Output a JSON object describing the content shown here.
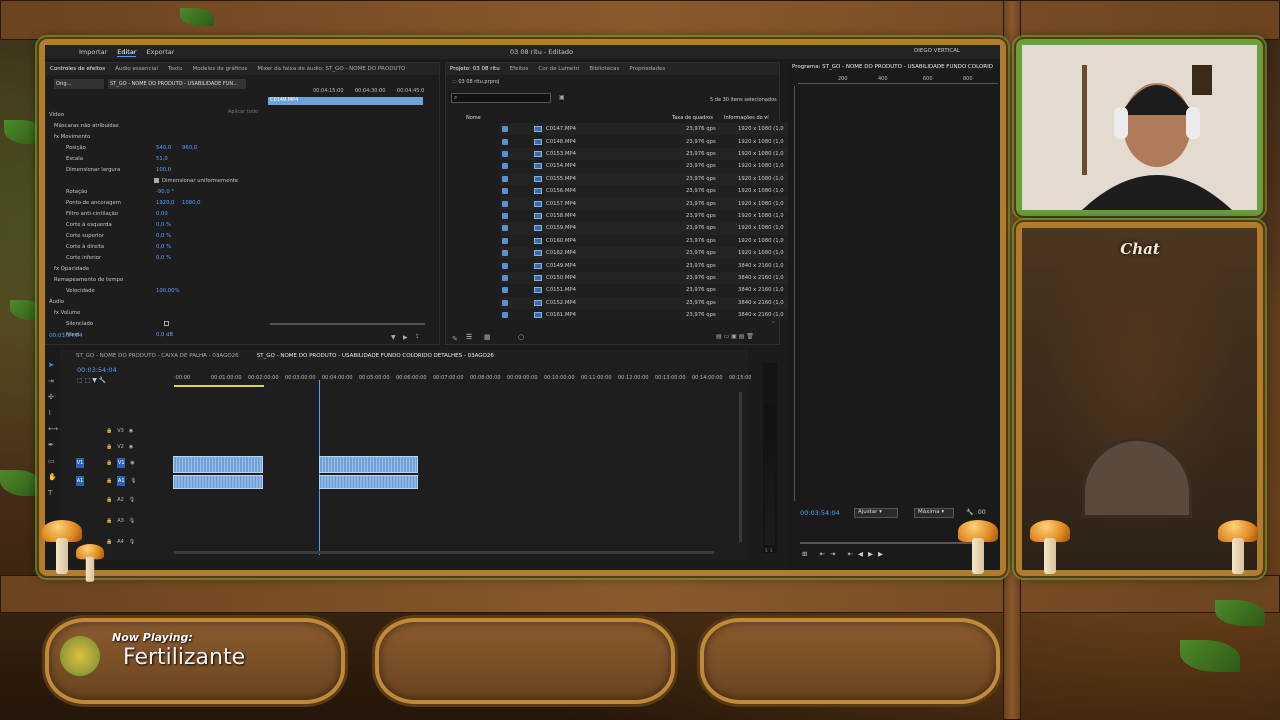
{
  "premiere": {
    "menu": {
      "importar": "Importar",
      "editar": "Editar",
      "exportar": "Exportar"
    },
    "window_title": "03 08 ritu - Editado",
    "workspace_user": "DIEGO VERTICAL",
    "effect_controls": {
      "tabs": [
        "Controles de efeitos",
        "Áudio essencial",
        "Texto",
        "Modelos de gráficos",
        "Mixer da faixa de áudio: ST_GO - NOME DO PRODUTO"
      ],
      "source_label": "Orig...",
      "sequence_label": "ST_GO - NOME DO PRODUTO - USABILIDADE FUN...",
      "clip_name": "C0149.MP4",
      "apply_label": "Aplicar todo",
      "rows": [
        {
          "label": "Vídeo",
          "v1": "",
          "v2": ""
        },
        {
          "label": "Máscaras não atribuídas",
          "v1": "",
          "v2": ""
        },
        {
          "label": "fx Movimento",
          "v1": "",
          "v2": ""
        },
        {
          "label": "Posição",
          "v1": "540,0",
          "v2": "960,0"
        },
        {
          "label": "Escala",
          "v1": "51,0",
          "v2": ""
        },
        {
          "label": "Dimensionar largura",
          "v1": "100,0",
          "v2": ""
        },
        {
          "label": "Dimensionar uniformemente",
          "v1": "",
          "v2": ""
        },
        {
          "label": "Rotação",
          "v1": "-90,0 °",
          "v2": ""
        },
        {
          "label": "Ponto de ancoragem",
          "v1": "1920,0",
          "v2": "1080,0"
        },
        {
          "label": "Filtro anti-cintilação",
          "v1": "0,00",
          "v2": ""
        },
        {
          "label": "Corte à esquerda",
          "v1": "0,0 %",
          "v2": ""
        },
        {
          "label": "Corte superior",
          "v1": "0,0 %",
          "v2": ""
        },
        {
          "label": "Corte à direita",
          "v1": "0,0 %",
          "v2": ""
        },
        {
          "label": "Corte inferior",
          "v1": "0,0 %",
          "v2": ""
        },
        {
          "label": "fx Opacidade",
          "v1": "",
          "v2": ""
        },
        {
          "label": "Remapeamento de tempo",
          "v1": "",
          "v2": ""
        },
        {
          "label": "Velocidade",
          "v1": "100,00%",
          "v2": ""
        },
        {
          "label": "Áudio",
          "v1": "",
          "v2": ""
        },
        {
          "label": "fx Volume",
          "v1": "",
          "v2": ""
        },
        {
          "label": "Silenciado",
          "v1": "",
          "v2": ""
        },
        {
          "label": "Nível",
          "v1": "0,0 dB",
          "v2": ""
        }
      ],
      "timecode": "00:03:54:04",
      "mini_ruler": [
        "00:04:15:00",
        "00:04:30:00",
        "00:04:45:0"
      ]
    },
    "project": {
      "tabs": [
        "Projeto: 03 08 ritu",
        "Efeitos",
        "Cor de Lumetri",
        "Bibliotecas",
        "Propriedades"
      ],
      "bin_name": "03 08 ritu.prproj",
      "selection_status": "5 de 30 itens selecionados",
      "columns": [
        "Nome",
        "Taxa de quadros",
        "Informações do ví"
      ],
      "files": [
        {
          "name": "C0147.MP4",
          "fps": "23,976 qps",
          "info": "1920 x 1080 (1,0"
        },
        {
          "name": "C0148.MP4",
          "fps": "23,976 qps",
          "info": "1920 x 1080 (1,0"
        },
        {
          "name": "C0153.MP4",
          "fps": "23,976 qps",
          "info": "1920 x 1080 (1,0"
        },
        {
          "name": "C0154.MP4",
          "fps": "23,976 qps",
          "info": "1920 x 1080 (1,0"
        },
        {
          "name": "C0155.MP4",
          "fps": "23,976 qps",
          "info": "1920 x 1080 (1,0"
        },
        {
          "name": "C0156.MP4",
          "fps": "23,976 qps",
          "info": "1920 x 1080 (1,0"
        },
        {
          "name": "C0157.MP4",
          "fps": "23,976 qps",
          "info": "1920 x 1080 (1,0"
        },
        {
          "name": "C0158.MP4",
          "fps": "23,976 qps",
          "info": "1920 x 1080 (1,0"
        },
        {
          "name": "C0159.MP4",
          "fps": "23,976 qps",
          "info": "1920 x 1080 (1,0"
        },
        {
          "name": "C0160.MP4",
          "fps": "23,976 qps",
          "info": "1920 x 1080 (1,0"
        },
        {
          "name": "C0162.MP4",
          "fps": "23,976 qps",
          "info": "1920 x 1080 (1,0"
        },
        {
          "name": "C0149.MP4",
          "fps": "23,976 qps",
          "info": "3840 x 2160 (1,0"
        },
        {
          "name": "C0150.MP4",
          "fps": "23,976 qps",
          "info": "3840 x 2160 (1,0"
        },
        {
          "name": "C0151.MP4",
          "fps": "23,976 qps",
          "info": "3840 x 2160 (1,0"
        },
        {
          "name": "C0152.MP4",
          "fps": "23,976 qps",
          "info": "3840 x 2160 (1,0"
        },
        {
          "name": "C0161.MP4",
          "fps": "23,976 qps",
          "info": "3840 x 2160 (1,0"
        }
      ]
    },
    "program": {
      "title": "Programa: ST_GO - NOME DO PRODUTO - USABILIDADE FUNDO COLORID",
      "ruler": [
        "200",
        "400",
        "600",
        "800"
      ],
      "timecode": "00:03:54:04",
      "fit": "Ajustar",
      "quality": "Máxima",
      "end_label": "00"
    },
    "timeline": {
      "tabs": [
        "ST_GO - NOME DO PRODUTO - CAIXA DE PALHA - 03AGO26",
        "ST_GO - NOME DO PRODUTO - USABILIDADE FUNDO COLORIDO DETALHES - 03AGO26"
      ],
      "timecode": "00:03:54:04",
      "ruler": [
        ":00:00",
        "00:01:00:00",
        "00:02:00:00",
        "00:03:00:00",
        "00:04:00:00",
        "00:05:00:00",
        "00:06:00:00",
        "00:07:00:00",
        "00:08:00:00",
        "00:09:00:00",
        "00:10:00:00",
        "00:11:00:00",
        "00:12:00:00",
        "00:13:00:00",
        "00:14:00:00",
        "00:15:00"
      ],
      "tracks": [
        {
          "id": "V3",
          "kind": "video"
        },
        {
          "id": "V2",
          "kind": "video"
        },
        {
          "id": "V1",
          "kind": "video",
          "source": "V1"
        },
        {
          "id": "A1",
          "kind": "audio",
          "source": "A1"
        },
        {
          "id": "A2",
          "kind": "audio"
        },
        {
          "id": "A3",
          "kind": "audio"
        },
        {
          "id": "A4",
          "kind": "audio"
        }
      ],
      "meter_labels": [
        "S",
        "S"
      ]
    }
  },
  "overlay": {
    "chat_title": "Chat",
    "now_playing_label": "Now Playing:",
    "song": "Fertilizante"
  },
  "colors": {
    "accent": "#4aa0ff",
    "clip": "#6fa3d8",
    "frame": "#b07d2c",
    "leaf": "#4f8a2a"
  }
}
